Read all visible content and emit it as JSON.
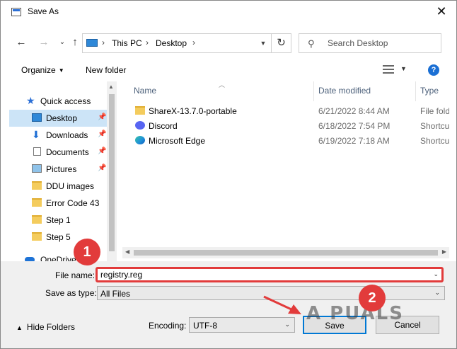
{
  "window": {
    "title": "Save As",
    "close_icon": "close-icon"
  },
  "nav": {
    "breadcrumb": [
      "This PC",
      "Desktop"
    ],
    "search_placeholder": "Search Desktop"
  },
  "commandbar": {
    "organize": "Organize",
    "new_folder": "New folder",
    "help": "?"
  },
  "sidebar": {
    "items": [
      {
        "label": "Quick access",
        "icon": "star-icon"
      },
      {
        "label": "Desktop",
        "icon": "desktop-icon",
        "pinned": true,
        "selected": true
      },
      {
        "label": "Downloads",
        "icon": "downloads-icon",
        "pinned": true
      },
      {
        "label": "Documents",
        "icon": "documents-icon",
        "pinned": true
      },
      {
        "label": "Pictures",
        "icon": "pictures-icon",
        "pinned": true
      },
      {
        "label": "DDU images",
        "icon": "folder-icon"
      },
      {
        "label": "Error Code 43",
        "icon": "folder-icon"
      },
      {
        "label": "Step 1",
        "icon": "folder-icon"
      },
      {
        "label": "Step 5",
        "icon": "folder-icon"
      },
      {
        "label": "OneDrive",
        "icon": "onedrive-icon"
      }
    ]
  },
  "filelist": {
    "columns": [
      "Name",
      "Date modified",
      "Type"
    ],
    "rows": [
      {
        "name": "ShareX-13.7.0-portable",
        "date": "6/21/2022 8:44 AM",
        "type": "File fold",
        "icon": "folder-icon"
      },
      {
        "name": "Discord",
        "date": "6/18/2022 7:54 PM",
        "type": "Shortcu",
        "icon": "discord-icon"
      },
      {
        "name": "Microsoft Edge",
        "date": "6/19/2022 7:18 AM",
        "type": "Shortcu",
        "icon": "edge-icon"
      }
    ]
  },
  "form": {
    "file_name_label": "File name:",
    "file_name_value": "registry.reg",
    "save_as_type_label": "Save as type:",
    "save_as_type_value": "All Files",
    "encoding_label": "Encoding:",
    "encoding_value": "UTF-8",
    "save_button": "Save",
    "cancel_button": "Cancel",
    "hide_folders": "Hide Folders"
  },
  "annotations": {
    "step1": "1",
    "step2": "2",
    "accent": "#e23b3b"
  },
  "watermark": "A PUALS"
}
